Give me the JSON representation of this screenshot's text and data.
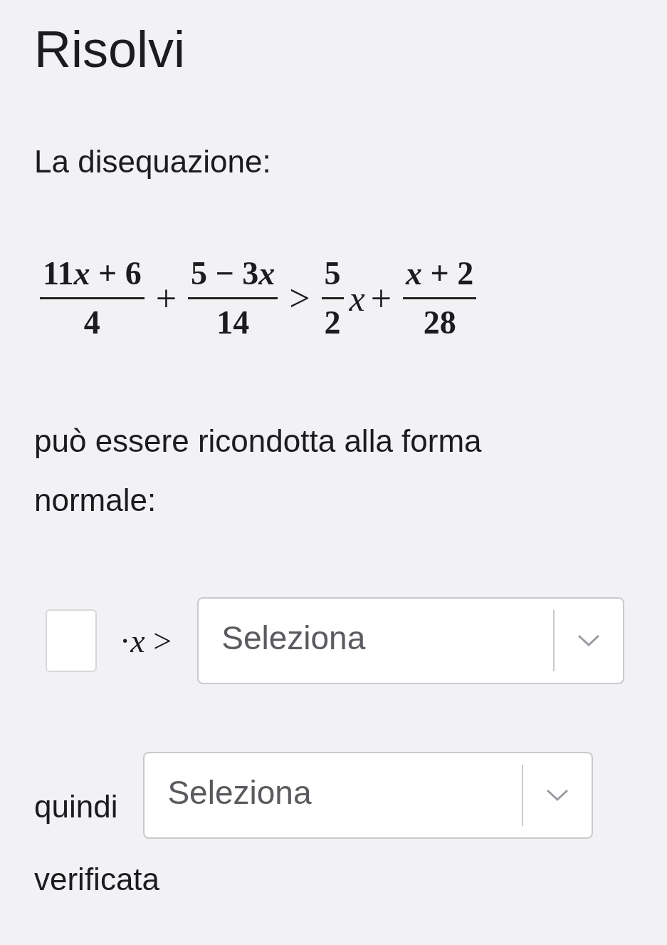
{
  "title": "Risolvi",
  "intro": "La disequazione:",
  "inequality": [
    {
      "kind": "fraction",
      "numerator": [
        {
          "kind": "num",
          "text": "11"
        },
        {
          "kind": "var",
          "text": "x"
        },
        {
          "kind": "num",
          "text": " + 6"
        }
      ],
      "denominator": "4"
    },
    {
      "kind": "op",
      "text": "+"
    },
    {
      "kind": "fraction",
      "numerator": [
        {
          "kind": "num",
          "text": "5 − 3"
        },
        {
          "kind": "var",
          "text": "x"
        }
      ],
      "denominator": "14"
    },
    {
      "kind": "op",
      "text": ">"
    },
    {
      "kind": "fraction",
      "numerator": [
        {
          "kind": "num",
          "text": "5"
        }
      ],
      "denominator": "2"
    },
    {
      "kind": "var",
      "text": "x"
    },
    {
      "kind": "op",
      "text": "+"
    },
    {
      "kind": "fraction",
      "numerator": [
        {
          "kind": "var",
          "text": "x"
        },
        {
          "kind": "num",
          "text": " + 2"
        }
      ],
      "denominator": "28"
    }
  ],
  "statement": "può essere ricondotta alla forma normale:",
  "normal_form": {
    "suffix": "·*x* >",
    "select": {
      "placeholder": "Seleziona"
    }
  },
  "conclusion": {
    "prefix": "quindi",
    "select": {
      "placeholder": "Seleziona"
    },
    "suffix": "verificata"
  }
}
